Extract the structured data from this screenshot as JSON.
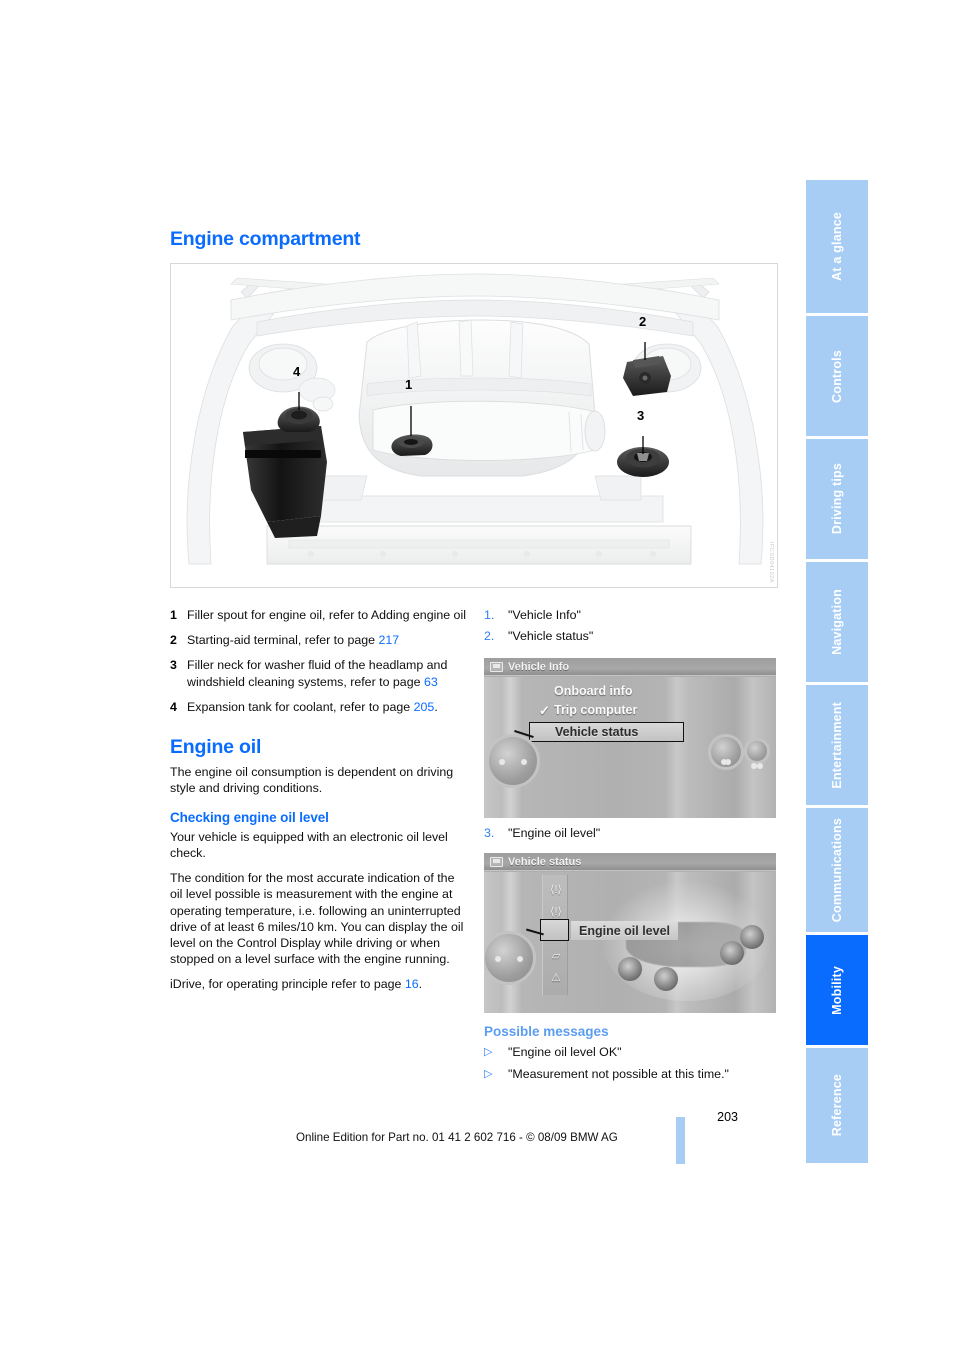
{
  "page": {
    "number": "203",
    "footer_text": "Online Edition for Part no. 01 41 2 602 716 - © 08/09 BMW AG"
  },
  "sidetabs": {
    "items": [
      {
        "label": "At a glance",
        "active": false
      },
      {
        "label": "Controls",
        "active": false
      },
      {
        "label": "Driving tips",
        "active": false
      },
      {
        "label": "Navigation",
        "active": false
      },
      {
        "label": "Entertainment",
        "active": false
      },
      {
        "label": "Communications",
        "active": false
      },
      {
        "label": "Mobility",
        "active": true
      },
      {
        "label": "Reference",
        "active": false
      }
    ],
    "active_color": "#0a6cff",
    "inactive_color": "#a8cdf5"
  },
  "sections": {
    "engine_compartment": {
      "heading": "Engine compartment",
      "figure_code": "IFCSD04102A",
      "callouts": [
        {
          "number": "1"
        },
        {
          "number": "2"
        },
        {
          "number": "3"
        },
        {
          "number": "4"
        }
      ],
      "legend": [
        {
          "n": "1",
          "text_before": "Filler spout for engine oil, refer to Adding engine oil",
          "link": "",
          "text_after": ""
        },
        {
          "n": "2",
          "text_before": "Starting-aid terminal, refer to page ",
          "link": "217",
          "text_after": ""
        },
        {
          "n": "3",
          "text_before": "Filler neck for washer fluid of the headlamp and windshield cleaning systems, refer to page ",
          "link": "63",
          "text_after": ""
        },
        {
          "n": "4",
          "text_before": "Expansion tank for coolant, refer to page ",
          "link": "205",
          "text_after": "."
        }
      ]
    },
    "engine_oil": {
      "heading": "Engine oil",
      "intro": "The engine oil consumption is dependent on driving style and driving conditions.",
      "subheading": "Checking engine oil level",
      "para1": "Your vehicle is equipped with an electronic oil level check.",
      "para2": "The condition for the most accurate indication of the oil level possible is measurement with the engine at operating temperature, i.e. following an uninterrupted drive of at least 6 miles/10 km. You can display the oil level on the Control Display while driving or when stopped on a level surface with the engine running.",
      "para3_before": "iDrive, for operating principle refer to page ",
      "para3_link": "16",
      "para3_after": "."
    },
    "steps": {
      "items": [
        {
          "n": "1.",
          "text": "\"Vehicle Info\""
        },
        {
          "n": "2.",
          "text": "\"Vehicle status\""
        },
        {
          "n": "3.",
          "text": "\"Engine oil level\""
        }
      ]
    },
    "possible_messages": {
      "heading": "Possible messages",
      "bullet_glyph": "▷",
      "items": [
        "\"Engine oil level OK\"",
        "\"Measurement not possible at this time.\""
      ]
    }
  },
  "idrive_screen_1": {
    "title": "Vehicle Info",
    "menu": [
      {
        "label": "Onboard info",
        "checked": false,
        "highlighted": false
      },
      {
        "label": "Trip computer",
        "checked": true,
        "highlighted": false
      },
      {
        "label": "Vehicle status",
        "checked": false,
        "highlighted": true
      }
    ],
    "check_glyph": "✓"
  },
  "idrive_screen_2": {
    "title": "Vehicle status",
    "tooltip": "Engine oil level",
    "icons": [
      "⟨!⟩",
      "⟨!⟩",
      "oil-can",
      "car-body",
      "⚠"
    ]
  }
}
